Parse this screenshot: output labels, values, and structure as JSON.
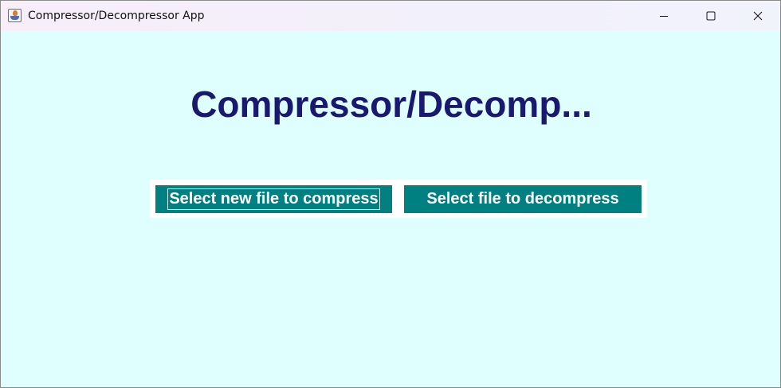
{
  "window": {
    "title": "Compressor/Decompressor App",
    "icon": "java-cup-icon",
    "controls": [
      "minimize-icon",
      "maximize-icon",
      "close-icon"
    ]
  },
  "main": {
    "heading": "Compressor/Decomp...",
    "compress_button": "Select new file to compress",
    "decompress_button": "Select file to decompress"
  },
  "colors": {
    "background": "#dfffff",
    "heading": "#191970",
    "button": "#008080",
    "button_text": "#ffffff",
    "panel": "#ffffff"
  }
}
